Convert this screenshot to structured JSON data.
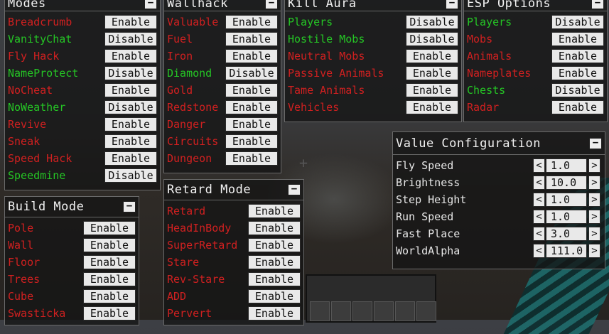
{
  "panels": {
    "modes": {
      "title": "Modes",
      "items": [
        {
          "label": "Breadcrumb",
          "state": "off",
          "button": "Enable"
        },
        {
          "label": "VanityChat",
          "state": "on",
          "button": "Disable"
        },
        {
          "label": "Fly Hack",
          "state": "off",
          "button": "Enable"
        },
        {
          "label": "NameProtect",
          "state": "on",
          "button": "Disable"
        },
        {
          "label": "NoCheat",
          "state": "off",
          "button": "Enable"
        },
        {
          "label": "NoWeather",
          "state": "on",
          "button": "Disable"
        },
        {
          "label": "Revive",
          "state": "off",
          "button": "Enable"
        },
        {
          "label": "Sneak",
          "state": "off",
          "button": "Enable"
        },
        {
          "label": "Speed Hack",
          "state": "off",
          "button": "Enable"
        },
        {
          "label": "Speedmine",
          "state": "on",
          "button": "Disable"
        }
      ]
    },
    "build_mode": {
      "title": "Build Mode",
      "items": [
        {
          "label": "Pole",
          "state": "off",
          "button": "Enable"
        },
        {
          "label": "Wall",
          "state": "off",
          "button": "Enable"
        },
        {
          "label": "Floor",
          "state": "off",
          "button": "Enable"
        },
        {
          "label": "Trees",
          "state": "off",
          "button": "Enable"
        },
        {
          "label": "Cube",
          "state": "off",
          "button": "Enable"
        },
        {
          "label": "Swasticka",
          "state": "off",
          "button": "Enable"
        }
      ]
    },
    "wallhack": {
      "title": "Wallhack",
      "items": [
        {
          "label": "Valuable",
          "state": "off",
          "button": "Enable"
        },
        {
          "label": "Fuel",
          "state": "off",
          "button": "Enable"
        },
        {
          "label": "Iron",
          "state": "off",
          "button": "Enable"
        },
        {
          "label": "Diamond",
          "state": "on",
          "button": "Disable"
        },
        {
          "label": "Gold",
          "state": "off",
          "button": "Enable"
        },
        {
          "label": "Redstone",
          "state": "off",
          "button": "Enable"
        },
        {
          "label": "Danger",
          "state": "off",
          "button": "Enable"
        },
        {
          "label": "Circuits",
          "state": "off",
          "button": "Enable"
        },
        {
          "label": "Dungeon",
          "state": "off",
          "button": "Enable"
        }
      ]
    },
    "retard_mode": {
      "title": "Retard Mode",
      "items": [
        {
          "label": "Retard",
          "state": "off",
          "button": "Enable"
        },
        {
          "label": "HeadInBody",
          "state": "off",
          "button": "Enable"
        },
        {
          "label": "SuperRetard",
          "state": "off",
          "button": "Enable"
        },
        {
          "label": "Stare",
          "state": "off",
          "button": "Enable"
        },
        {
          "label": "Rev-Stare",
          "state": "off",
          "button": "Enable"
        },
        {
          "label": "ADD",
          "state": "off",
          "button": "Enable"
        },
        {
          "label": "Pervert",
          "state": "off",
          "button": "Enable"
        }
      ]
    },
    "kill_aura": {
      "title": "Kill Aura",
      "items": [
        {
          "label": "Players",
          "state": "on",
          "button": "Disable"
        },
        {
          "label": "Hostile Mobs",
          "state": "on",
          "button": "Disable"
        },
        {
          "label": "Neutral Mobs",
          "state": "off",
          "button": "Enable"
        },
        {
          "label": "Passive Animals",
          "state": "off",
          "button": "Enable"
        },
        {
          "label": "Tame Animals",
          "state": "off",
          "button": "Enable"
        },
        {
          "label": "Vehicles",
          "state": "off",
          "button": "Enable"
        }
      ]
    },
    "esp_options": {
      "title": "ESP Options",
      "items": [
        {
          "label": "Players",
          "state": "on",
          "button": "Disable"
        },
        {
          "label": "Mobs",
          "state": "off",
          "button": "Enable"
        },
        {
          "label": "Animals",
          "state": "off",
          "button": "Enable"
        },
        {
          "label": "Nameplates",
          "state": "off",
          "button": "Enable"
        },
        {
          "label": "Chests",
          "state": "on",
          "button": "Disable"
        },
        {
          "label": "Radar",
          "state": "off",
          "button": "Enable"
        }
      ]
    },
    "value_configuration": {
      "title": "Value Configuration",
      "items": [
        {
          "label": "Fly Speed",
          "value": "1.0"
        },
        {
          "label": "Brightness",
          "value": "10.0"
        },
        {
          "label": "Step Height",
          "value": "1.0"
        },
        {
          "label": "Run Speed",
          "value": "1.0"
        },
        {
          "label": "Fast Place",
          "value": "3.0"
        },
        {
          "label": "WorldAlpha",
          "value": "111.0"
        }
      ]
    }
  },
  "symbols": {
    "collapse": "−",
    "decrease": "<",
    "increase": ">"
  },
  "colors": {
    "enabled": "#25c525",
    "disabled": "#d02020",
    "panel_bg": "#141414",
    "button_bg": "#e9e9e9"
  }
}
